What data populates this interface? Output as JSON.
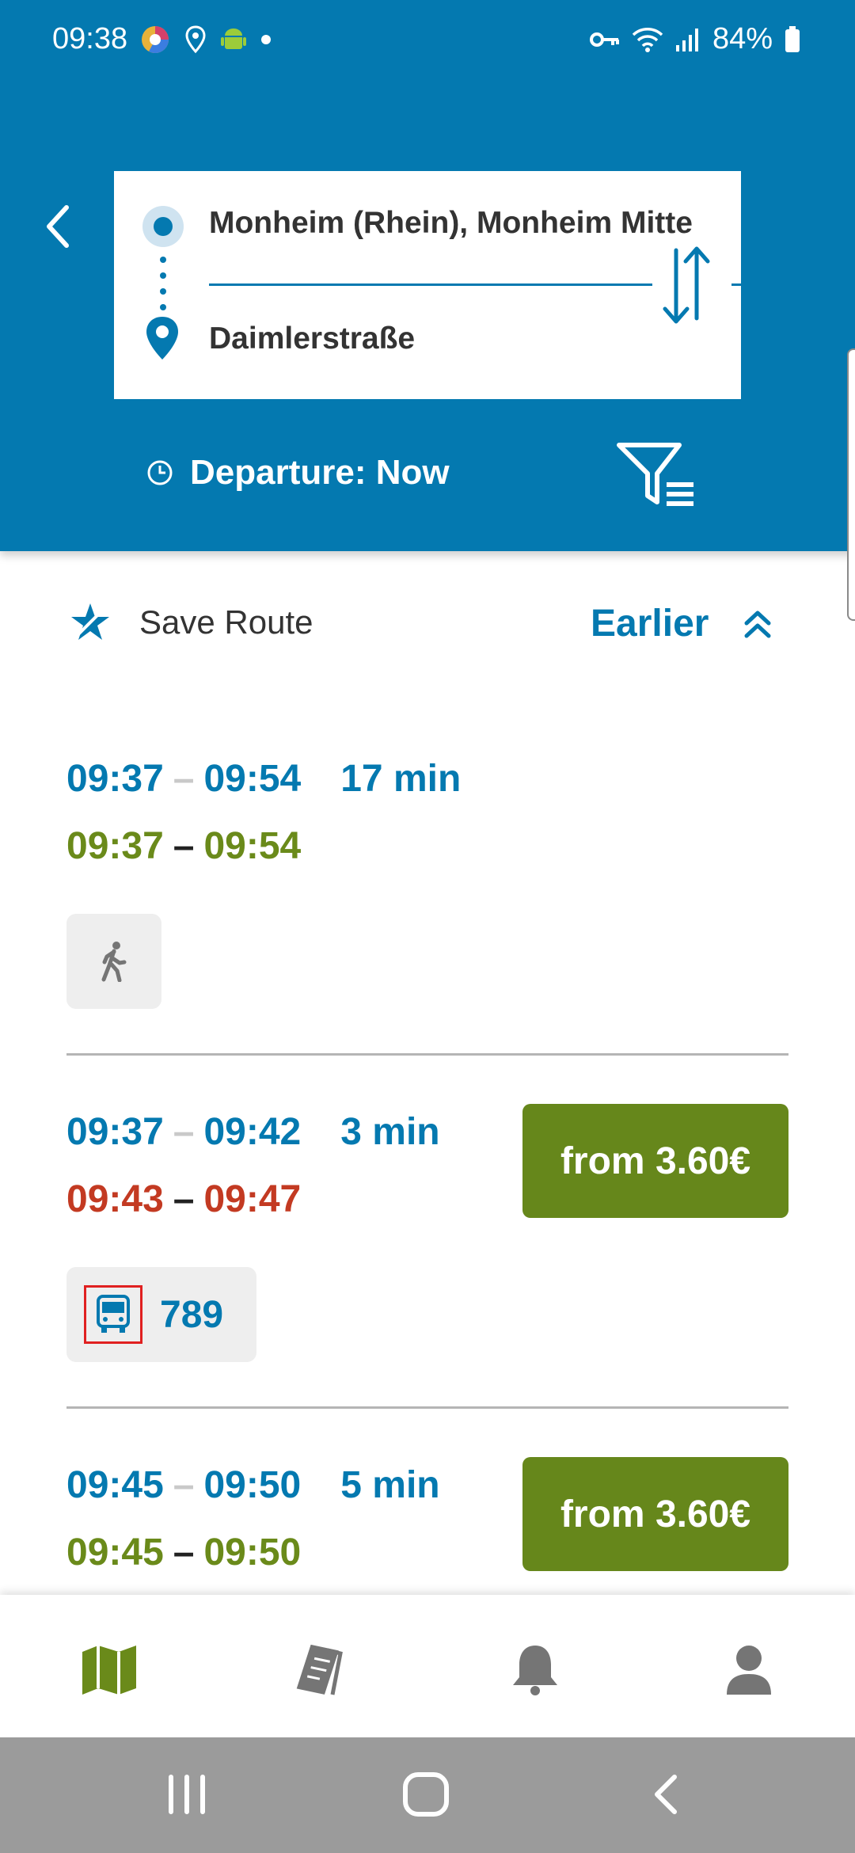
{
  "status_bar": {
    "time": "09:38",
    "battery": "84%"
  },
  "route": {
    "from": "Monheim (Rhein), Monheim Mitte",
    "to": "Daimlerstraße"
  },
  "departure": {
    "label": "Departure: Now"
  },
  "actions": {
    "save_route": "Save Route",
    "earlier": "Earlier"
  },
  "connections": [
    {
      "planned_start": "09:37",
      "planned_end": "09:54",
      "duration": "17 min",
      "rt_start": "09:37",
      "rt_end": "09:54",
      "rt_status": "on-time",
      "price": null,
      "modes": [
        {
          "icon": "walk-icon",
          "line": ""
        }
      ]
    },
    {
      "planned_start": "09:37",
      "planned_end": "09:42",
      "duration": "3 min",
      "rt_start": "09:43",
      "rt_end": "09:47",
      "rt_status": "delayed",
      "price": "from 3.60€",
      "modes": [
        {
          "icon": "bus-icon",
          "line": "789"
        }
      ]
    },
    {
      "planned_start": "09:45",
      "planned_end": "09:50",
      "duration": "5 min",
      "rt_start": "09:45",
      "rt_end": "09:50",
      "rt_status": "on-time",
      "price": "from 3.60€",
      "modes": []
    }
  ],
  "separators": {
    "dash": "–"
  },
  "colors": {
    "brand_blue": "#0479b0",
    "on_time_green": "#6a8a1a",
    "delay_red": "#c33a22",
    "price_green": "#66871b",
    "nav_active": "#6a8a1a",
    "nav_inactive": "#757575"
  },
  "bottom_nav": [
    {
      "icon": "map-icon",
      "active": true
    },
    {
      "icon": "tickets-icon",
      "active": false
    },
    {
      "icon": "bell-icon",
      "active": false
    },
    {
      "icon": "profile-icon",
      "active": false
    }
  ]
}
